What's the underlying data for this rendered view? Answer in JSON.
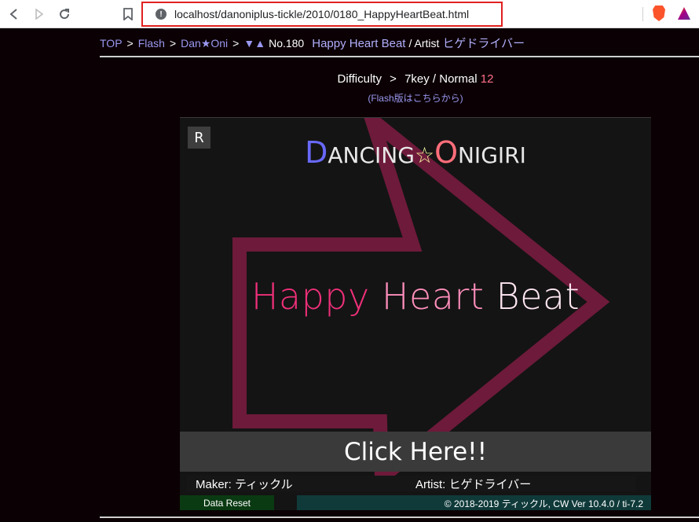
{
  "browser": {
    "url": "localhost/danoniplus-tickle/2010/0180_HappyHeartBeat.html",
    "back_icon": "back-arrow-icon",
    "forward_icon": "forward-arrow-icon",
    "reload_icon": "reload-icon",
    "bookmark_icon": "bookmark-icon",
    "info_icon": "!",
    "url_highlight_color": "#e02020"
  },
  "breadcrumb": {
    "top": "TOP",
    "flash": "Flash",
    "danoni": "Dan★Oni",
    "sep": ">",
    "nav": "▼▲",
    "number": "No.180",
    "song": "Happy Heart Beat",
    "artist_prefix": "/ Artist",
    "artist": "ヒゲドライバー"
  },
  "difficulty": {
    "label": "Difficulty",
    "sep": ">",
    "mode": "7key / Normal",
    "level": "12"
  },
  "flash_link": {
    "open": "(",
    "text": "Flash版はこちらから",
    "close": ")"
  },
  "game": {
    "reset_button": "R",
    "logo": {
      "d": "D",
      "ancing": "ANCING",
      "star": "☆",
      "o": "O",
      "nigiri": "NIGIRI"
    },
    "title": {
      "word1": "Happy",
      "word2": "Heart",
      "word3": "Beat"
    },
    "click_here": "Click Here!!",
    "maker": "Maker: ティックル",
    "artist": "Artist: ヒゲドライバー",
    "data_reset": "Data Reset",
    "copyright": "© 2018-2019 ティックル, CW Ver 10.4.0 / ti-7.2",
    "colors": {
      "arrow": "#6e1a3a",
      "logo_d": "#6868f8",
      "logo_o": "#ff6e7a",
      "title_happy": "#f0307a",
      "title_heart": "#ff8fbc",
      "title_beat": "#ffe7f2"
    }
  }
}
